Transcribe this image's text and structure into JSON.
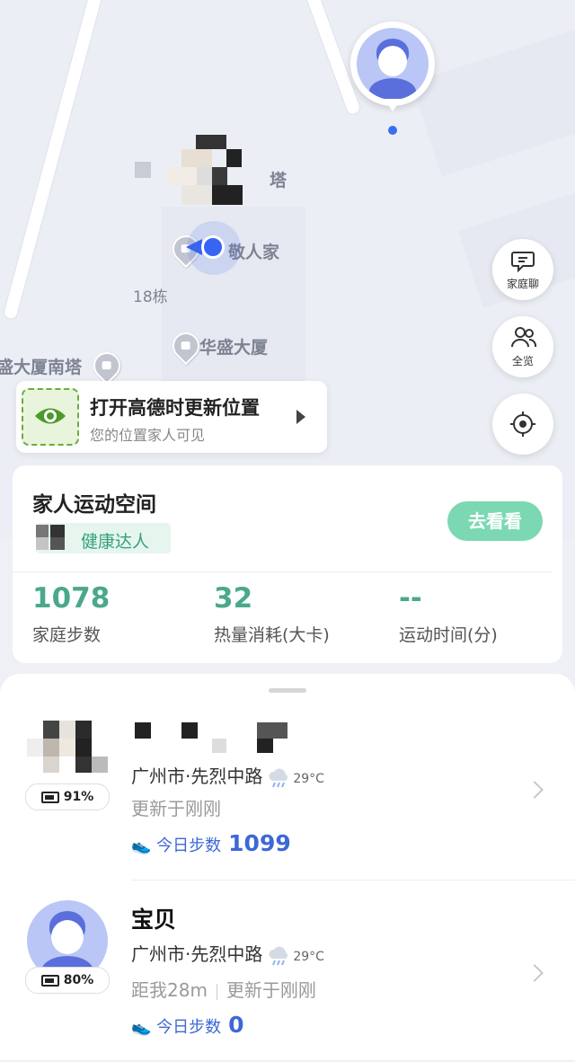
{
  "map": {
    "labels": {
      "tower": "塔",
      "family_poi": "敬人家",
      "building_18": "18栋",
      "huasheng": "华盛大厦",
      "south_tower": "盛大厦南塔"
    },
    "colors": {
      "accent": "#3864f2",
      "pin": "#c1c5cf"
    }
  },
  "fabs": {
    "family_chat": {
      "icon": "chat-bubble-icon",
      "label": "家庭聊"
    },
    "overview": {
      "icon": "people-icon",
      "label": "全览"
    },
    "locate": {
      "icon": "crosshair-icon"
    }
  },
  "banner": {
    "icon": "eye-icon",
    "title": "打开高德时更新位置",
    "subtitle": "您的位置家人可见"
  },
  "activity": {
    "title": "家人运动空间",
    "tag": "健康达人",
    "button": "去看看",
    "accent": "#4aa88c",
    "stats": [
      {
        "value": "1078",
        "caption": "家庭步数"
      },
      {
        "value": "32",
        "caption": "热量消耗(大卡)"
      },
      {
        "value": "--",
        "caption": "运动时间(分)"
      }
    ]
  },
  "members": [
    {
      "name": "",
      "battery": "91%",
      "location": "广州市·先烈中路",
      "weather_icon": "rain-cloud-icon",
      "temperature": "29°C",
      "distance": "",
      "updated": "更新于刚刚",
      "steps_label": "今日步数",
      "steps": "1099"
    },
    {
      "name": "宝贝",
      "battery": "80%",
      "location": "广州市·先烈中路",
      "weather_icon": "rain-cloud-icon",
      "temperature": "29°C",
      "distance": "距我28m",
      "updated": "更新于刚刚",
      "steps_label": "今日步数",
      "steps": "0"
    }
  ]
}
